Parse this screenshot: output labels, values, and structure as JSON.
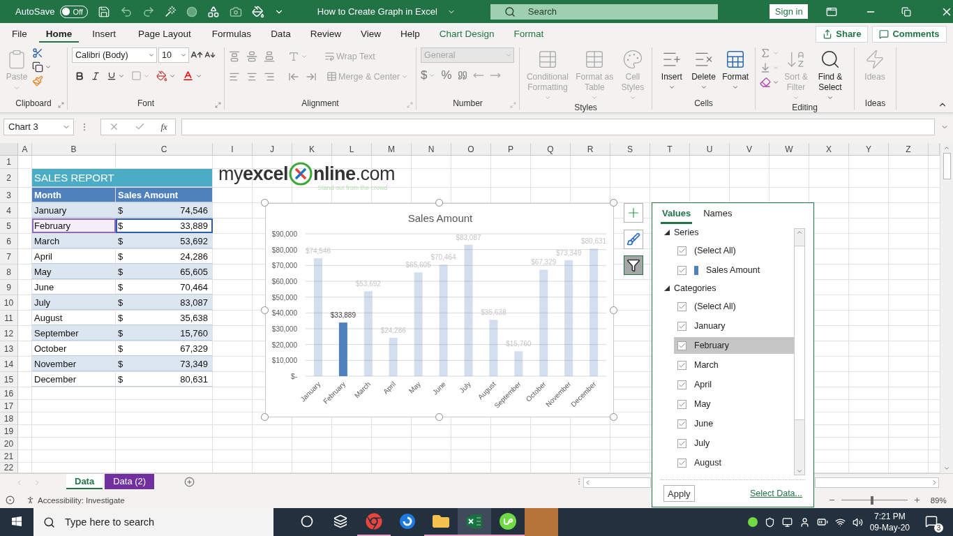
{
  "title_bar": {
    "autosave_label": "AutoSave",
    "autosave_toggle": {
      "label": "Off",
      "on": false
    },
    "document_title": "How to Create Graph in Excel",
    "search": {
      "placeholder": "Search"
    },
    "sign_in": "Sign in"
  },
  "menu_tabs": [
    {
      "label": "File",
      "selected": false,
      "kind": "plain"
    },
    {
      "label": "Home",
      "selected": true,
      "kind": "plain"
    },
    {
      "label": "Insert",
      "selected": false,
      "kind": "plain"
    },
    {
      "label": "Page Layout",
      "selected": false,
      "kind": "plain"
    },
    {
      "label": "Formulas",
      "selected": false,
      "kind": "plain"
    },
    {
      "label": "Data",
      "selected": false,
      "kind": "plain"
    },
    {
      "label": "Review",
      "selected": false,
      "kind": "plain"
    },
    {
      "label": "View",
      "selected": false,
      "kind": "plain"
    },
    {
      "label": "Help",
      "selected": false,
      "kind": "plain"
    },
    {
      "label": "Chart Design",
      "selected": false,
      "kind": "contextual"
    },
    {
      "label": "Format",
      "selected": false,
      "kind": "contextual"
    }
  ],
  "share": "Share",
  "comments": "Comments",
  "ribbon": {
    "clipboard": {
      "label": "Clipboard",
      "paste": {
        "label": "Paste",
        "disabled": true
      }
    },
    "font": {
      "label": "Font",
      "font_name": "Calibri (Body)",
      "font_size": "10"
    },
    "alignment": {
      "label": "Alignment",
      "wrap_text": {
        "label": "Wrap Text",
        "disabled": true
      },
      "merge_center": {
        "label": "Merge & Center",
        "disabled": true
      }
    },
    "number": {
      "label": "Number",
      "format": {
        "value": "General",
        "disabled": true
      },
      "currency": "$",
      "percent": "%"
    },
    "styles": {
      "label": "Styles",
      "buttons": [
        {
          "label": "Conditional Formatting",
          "disabled": true,
          "kind": "conditional"
        },
        {
          "label": "Format as Table",
          "disabled": true,
          "kind": "table"
        },
        {
          "label": "Cell Styles",
          "disabled": true,
          "kind": "styles"
        }
      ]
    },
    "cells": {
      "label": "Cells",
      "buttons": [
        {
          "label": "Insert",
          "disabled": false,
          "kind": "insert"
        },
        {
          "label": "Delete",
          "disabled": false,
          "kind": "delete"
        },
        {
          "label": "Format",
          "disabled": false,
          "kind": "format"
        }
      ]
    },
    "editing": {
      "label": "Editing",
      "buttons": [
        {
          "label": "Sort & Filter",
          "disabled": true,
          "kind": "sort"
        },
        {
          "label": "Find & Select",
          "disabled": false,
          "kind": "find"
        }
      ]
    },
    "ideas": {
      "label": "Ideas",
      "button": {
        "label": "Ideas",
        "disabled": true
      }
    }
  },
  "formula_bar": {
    "name_box": "Chart 3",
    "fx": "fx"
  },
  "sheet": {
    "columns": [
      "A",
      "B",
      "C",
      "I",
      "J",
      "K",
      "L",
      "M",
      "N",
      "O",
      "P",
      "Q",
      "R",
      "S",
      "T",
      "U",
      "V",
      "W",
      "X",
      "Y",
      "Z"
    ],
    "rows": [
      "1",
      "2",
      "3",
      "4",
      "5",
      "6",
      "7",
      "8",
      "9",
      "10",
      "11",
      "12",
      "13",
      "14",
      "15",
      "16",
      "17",
      "18",
      "19",
      "20",
      "21",
      "22"
    ]
  },
  "logo": {
    "left": "my**excel**",
    "right": "**nline**.com",
    "tagline": "Stand out from the crowd"
  },
  "table": {
    "title": "SALES REPORT",
    "headers": [
      "Month",
      "Sales Amount"
    ],
    "rows": [
      {
        "month": "January",
        "currency": "$",
        "amount": "74,546",
        "highlighted": false
      },
      {
        "month": "February",
        "currency": "$",
        "amount": "33,889",
        "highlighted": true
      },
      {
        "month": "March",
        "currency": "$",
        "amount": "53,692",
        "highlighted": false
      },
      {
        "month": "April",
        "currency": "$",
        "amount": "24,286",
        "highlighted": false
      },
      {
        "month": "May",
        "currency": "$",
        "amount": "65,605",
        "highlighted": false
      },
      {
        "month": "June",
        "currency": "$",
        "amount": "70,464",
        "highlighted": false
      },
      {
        "month": "July",
        "currency": "$",
        "amount": "83,087",
        "highlighted": false
      },
      {
        "month": "August",
        "currency": "$",
        "amount": "35,638",
        "highlighted": false
      },
      {
        "month": "September",
        "currency": "$",
        "amount": "15,760",
        "highlighted": false
      },
      {
        "month": "October",
        "currency": "$",
        "amount": "67,329",
        "highlighted": false
      },
      {
        "month": "November",
        "currency": "$",
        "amount": "73,349",
        "highlighted": false
      },
      {
        "month": "December",
        "currency": "$",
        "amount": "80,631",
        "highlighted": false
      }
    ]
  },
  "chart": {
    "chart_data": {
      "type": "bar",
      "title": "Sales Amount",
      "categories": [
        "January",
        "February",
        "March",
        "April",
        "May",
        "June",
        "July",
        "August",
        "September",
        "October",
        "November",
        "December"
      ],
      "grid": true,
      "series": [
        {
          "color": "#4f81bd",
          "values": [
            74546,
            33889,
            53692,
            24286,
            65605,
            70464,
            83087,
            35638,
            15760,
            67329,
            73349,
            80631
          ]
        }
      ],
      "ylim": [
        0,
        90000
      ],
      "yticks": [
        {
          "value": 0,
          "label": "$-"
        },
        {
          "value": 10000,
          "label": "$10,000"
        },
        {
          "value": 20000,
          "label": "$20,000"
        },
        {
          "value": 30000,
          "label": "$30,000"
        },
        {
          "value": 40000,
          "label": "$40,000"
        },
        {
          "value": 50000,
          "label": "$50,000"
        },
        {
          "value": 60000,
          "label": "$60,000"
        },
        {
          "value": 70000,
          "label": "$70,000"
        },
        {
          "value": 80000,
          "label": "$80,000"
        },
        {
          "value": 90000,
          "label": "$90,000"
        }
      ],
      "value_labels": [
        "$74,546",
        "$33,889",
        "$53,692",
        "$24,286",
        "$65,605",
        "$70,464",
        "$83,087",
        "$35,638",
        "$15,760",
        "$67,329",
        "$73,349",
        "$80,631"
      ]
    }
  },
  "chart_buttons": [
    {
      "kind": "elements",
      "selected": false
    },
    {
      "kind": "styles",
      "selected": false
    },
    {
      "kind": "filter",
      "selected": true
    }
  ],
  "filter_panel": {
    "tabs": [
      {
        "label": "Values",
        "selected": true
      },
      {
        "label": "Names",
        "selected": false
      }
    ],
    "series": {
      "label": "Series",
      "expanded": true,
      "select_all": {
        "label": "(Select All)",
        "checked": true
      },
      "items": [
        {
          "label": "Sales Amount",
          "checked": true,
          "color": "#4f81bd"
        }
      ]
    },
    "categories": {
      "label": "Categories",
      "expanded": true,
      "select_all": {
        "label": "(Select All)",
        "checked": true
      },
      "items": [
        {
          "label": "January",
          "checked": true,
          "selected": false
        },
        {
          "label": "February",
          "checked": true,
          "selected": true
        },
        {
          "label": "March",
          "checked": true,
          "selected": false
        },
        {
          "label": "April",
          "checked": true,
          "selected": false
        },
        {
          "label": "May",
          "checked": true,
          "selected": false
        },
        {
          "label": "June",
          "checked": true,
          "selected": false
        },
        {
          "label": "July",
          "checked": true,
          "selected": false
        },
        {
          "label": "August",
          "checked": true,
          "selected": false
        }
      ]
    },
    "apply": "Apply",
    "select_data": "Select Data..."
  },
  "sheet_tabs": [
    {
      "label": "Data",
      "selected": true
    },
    {
      "label": "Data (2)",
      "selected": false,
      "color": "#7030a0"
    }
  ],
  "status_bar": {
    "accessibility": "Accessibility: Investigate",
    "zoom": {
      "level": 0.47,
      "reading": "89%"
    }
  },
  "taskbar": {
    "search_placeholder": "Type here to search",
    "apps": [
      {
        "kind": "cortana",
        "active": false,
        "running": false
      },
      {
        "kind": "task_view",
        "active": false,
        "running": false
      },
      {
        "kind": "browser",
        "active": false,
        "running": true
      },
      {
        "kind": "blue_app",
        "active": false,
        "running": false
      },
      {
        "kind": "files",
        "active": false,
        "running": true
      },
      {
        "kind": "spreadsheet",
        "active": true,
        "running": true
      },
      {
        "kind": "green_app",
        "active": false,
        "running": true
      },
      {
        "kind": "orange_window",
        "active": false,
        "running": false
      }
    ],
    "time": "7:21 PM",
    "date": "09-May-20",
    "notifications": "3"
  }
}
